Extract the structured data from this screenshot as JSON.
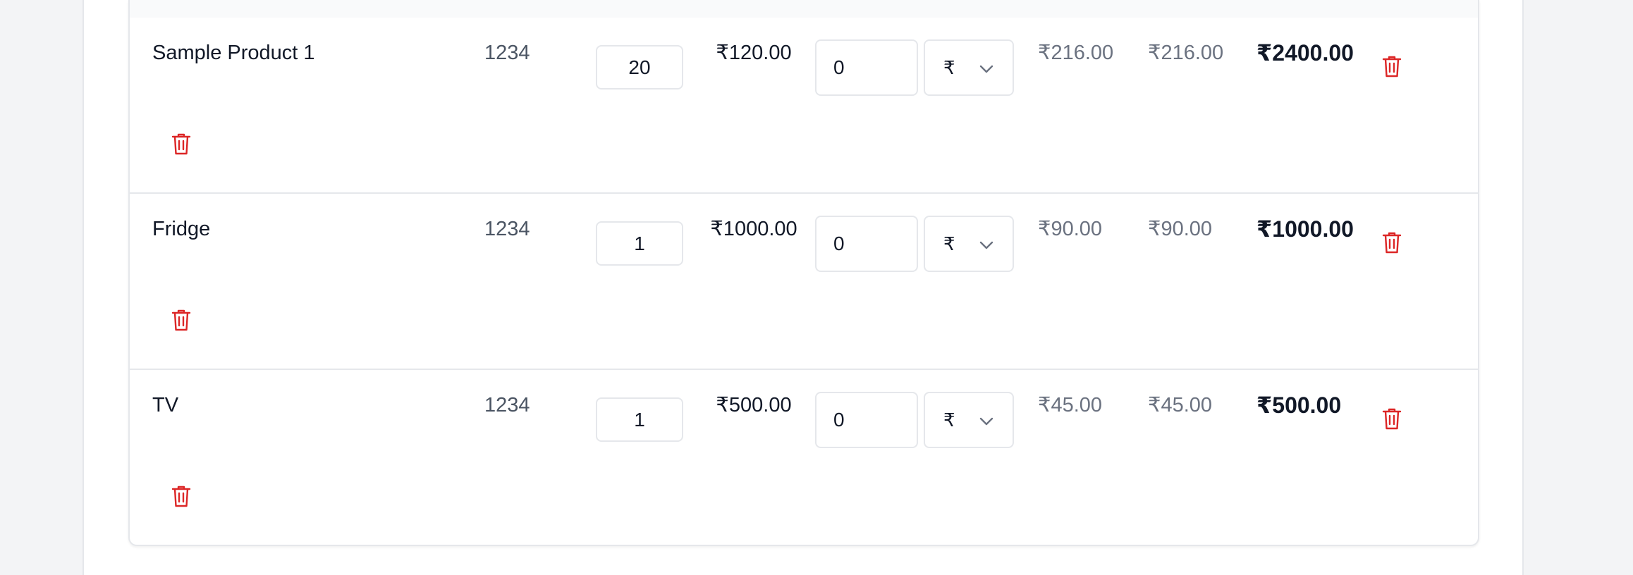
{
  "currency_symbol": "₹",
  "rows": [
    {
      "product": "Sample Product 1",
      "hsn": "1234",
      "quantity": "20",
      "price": "₹120.00",
      "discount": "0",
      "discount_type": "₹",
      "tax_1": "₹216.00",
      "tax_2": "₹216.00",
      "total": "₹2400.00"
    },
    {
      "product": "Fridge",
      "hsn": "1234",
      "quantity": "1",
      "price": "₹1000.00",
      "discount": "0",
      "discount_type": "₹",
      "tax_1": "₹90.00",
      "tax_2": "₹90.00",
      "total": "₹1000.00"
    },
    {
      "product": "TV",
      "hsn": "1234",
      "quantity": "1",
      "price": "₹500.00",
      "discount": "0",
      "discount_type": "₹",
      "tax_1": "₹45.00",
      "tax_2": "₹45.00",
      "total": "₹500.00"
    }
  ],
  "icons": {
    "delete": "trash-icon",
    "dropdown": "chevron-down-icon"
  },
  "colors": {
    "delete_red": "#dc2626",
    "muted_text": "#6b7280",
    "border": "#e5e7eb"
  }
}
